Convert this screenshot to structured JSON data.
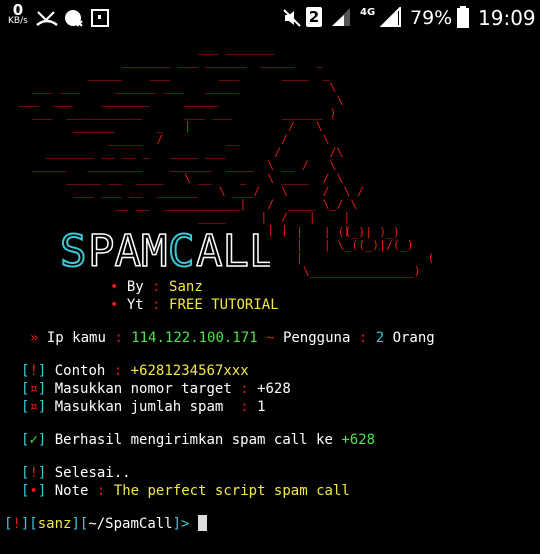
{
  "status_bar": {
    "net_speed_value": "0",
    "net_speed_unit": "KB/s",
    "sim_slot": "2",
    "network_type": "4G",
    "battery_percent": "79%",
    "time": "19:09",
    "icons": [
      "missed-call-icon",
      "crossed-signal-icon",
      "media-icon",
      "screenshot-icon",
      "mute-icon",
      "sim-2-icon",
      "signal-icon",
      "lte-signal-icon",
      "battery-icon"
    ]
  },
  "banner": {
    "title": "SPAM CALL",
    "by_label": "By",
    "by_value": "Sanz",
    "yt_label": "Yt",
    "yt_value": "FREE TUTORIAL"
  },
  "info": {
    "ip_label": "Ip kamu",
    "ip_value": "114.122.100.171",
    "users_label": "Pengguna",
    "users_count": "2",
    "users_unit": "Orang"
  },
  "prompts": {
    "example_label": "Contoh",
    "example_value": "+6281234567xxx",
    "target_label": "Masukkan nomor target",
    "target_value": "+628",
    "count_label": "Masukkan jumlah spam ",
    "count_value": "1"
  },
  "result": {
    "message": "Berhasil mengirimkan spam call ke",
    "number": "+628"
  },
  "done": {
    "done_text": "Selesai..",
    "note_label": "Note",
    "note_text": "The perfect script spam call"
  },
  "shell": {
    "flag": "!",
    "user": "sanz",
    "path": "~/SpamCall"
  }
}
